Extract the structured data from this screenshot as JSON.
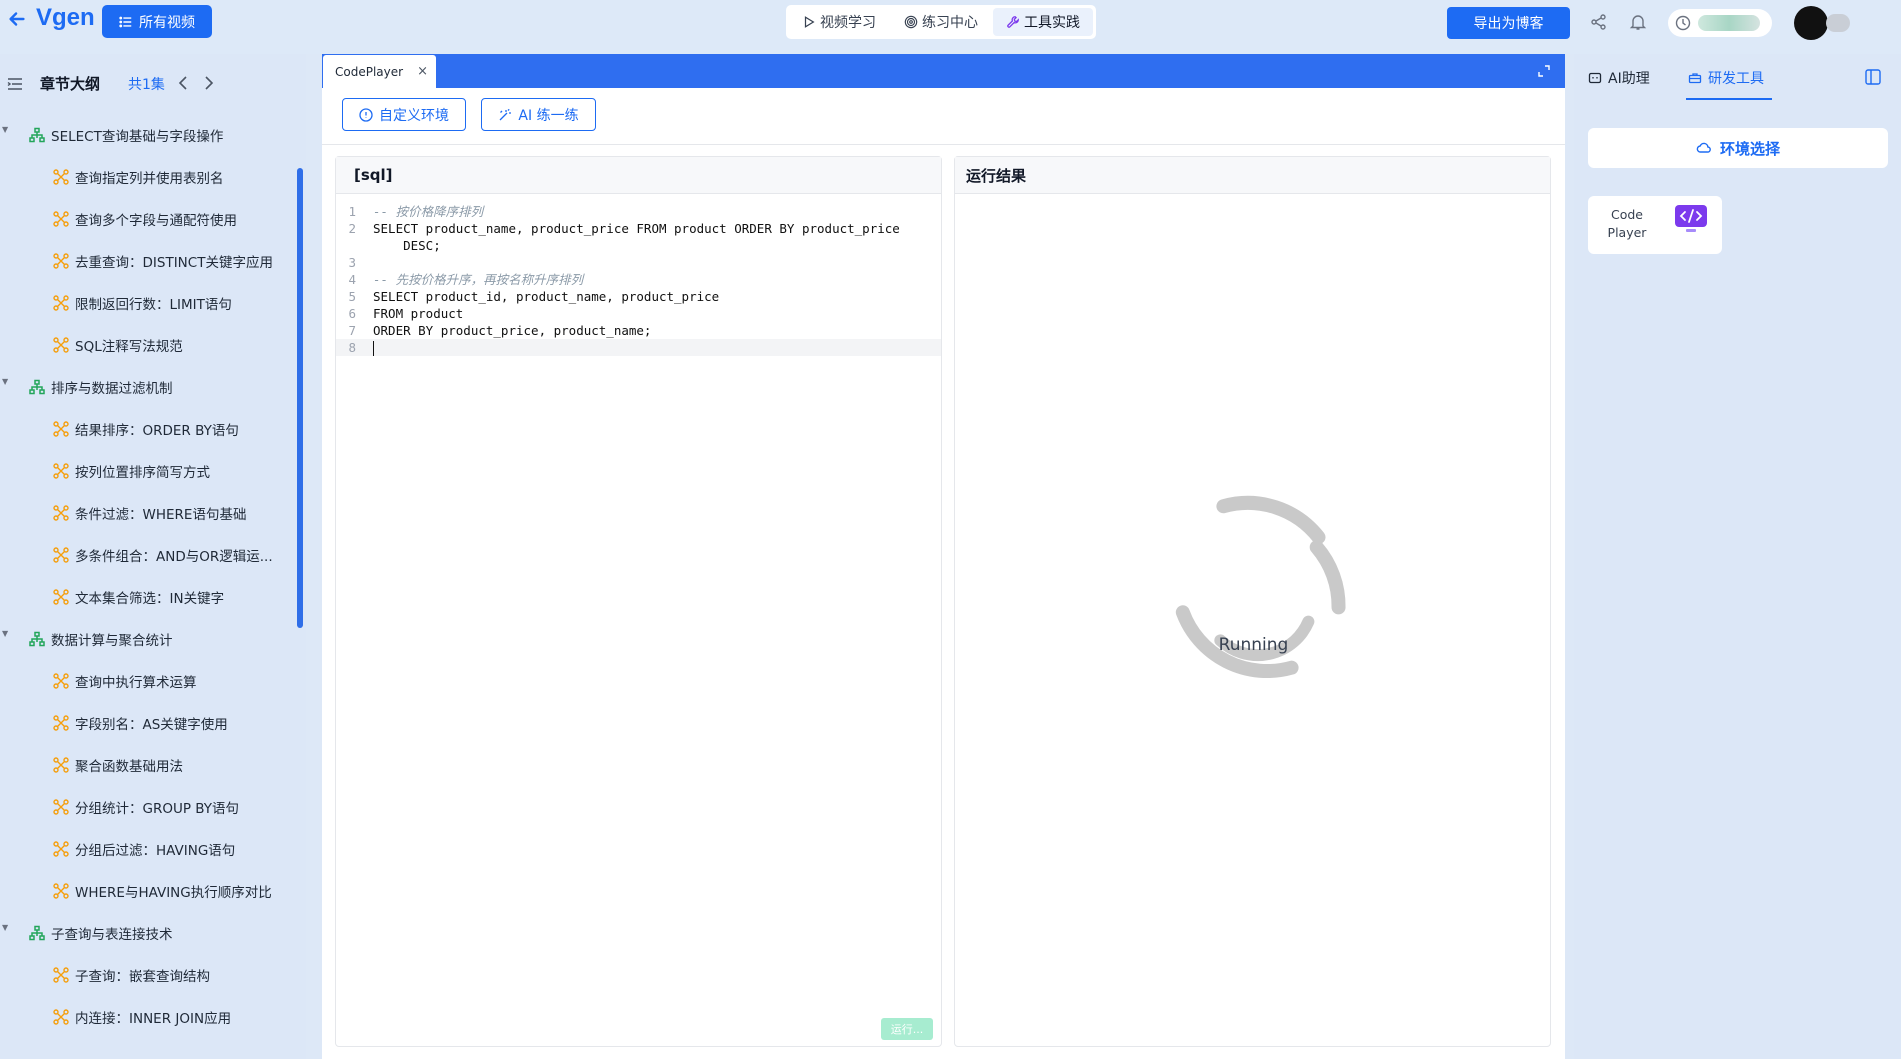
{
  "header": {
    "logo": "Vgen",
    "all_videos_label": "所有视频",
    "tabs": [
      {
        "label": "视频学习",
        "icon": "play-icon"
      },
      {
        "label": "练习中心",
        "icon": "target-icon"
      },
      {
        "label": "工具实践",
        "icon": "wrench-icon",
        "active": true
      }
    ],
    "export_label": "导出为博客",
    "accent_color": "#1d6bf3"
  },
  "sidebar": {
    "title": "章节大纲",
    "count": "共1集",
    "items": [
      {
        "type": "chapter",
        "label": "SELECT查询基础与字段操作"
      },
      {
        "type": "section",
        "label": "查询指定列并使用表别名"
      },
      {
        "type": "section",
        "label": "查询多个字段与通配符使用"
      },
      {
        "type": "section",
        "label": "去重查询：DISTINCT关键字应用"
      },
      {
        "type": "section",
        "label": "限制返回行数：LIMIT语句"
      },
      {
        "type": "section",
        "label": "SQL注释写法规范"
      },
      {
        "type": "chapter",
        "label": "排序与数据过滤机制"
      },
      {
        "type": "section",
        "label": "结果排序：ORDER BY语句"
      },
      {
        "type": "section",
        "label": "按列位置排序简写方式"
      },
      {
        "type": "section",
        "label": "条件过滤：WHERE语句基础"
      },
      {
        "type": "section",
        "label": "多条件组合：AND与OR逻辑运..."
      },
      {
        "type": "section",
        "label": "文本集合筛选：IN关键字"
      },
      {
        "type": "chapter",
        "label": "数据计算与聚合统计"
      },
      {
        "type": "section",
        "label": "查询中执行算术运算"
      },
      {
        "type": "section",
        "label": "字段别名：AS关键字使用"
      },
      {
        "type": "section",
        "label": "聚合函数基础用法"
      },
      {
        "type": "section",
        "label": "分组统计：GROUP BY语句"
      },
      {
        "type": "section",
        "label": "分组后过滤：HAVING语句"
      },
      {
        "type": "section",
        "label": "WHERE与HAVING执行顺序对比"
      },
      {
        "type": "chapter",
        "label": "子查询与表连接技术"
      },
      {
        "type": "section",
        "label": "子查询：嵌套查询结构"
      },
      {
        "type": "section",
        "label": "内连接：INNER JOIN应用"
      }
    ]
  },
  "main": {
    "tab_label": "CodePlayer",
    "tab_close": "×",
    "toolbar": {
      "custom_env_label": "自定义环境",
      "ai_practice_label": "AI 练一练"
    },
    "editor": {
      "title": "[sql]",
      "lines": [
        {
          "n": "1",
          "text": "-- 按价格降序排列",
          "comment": true
        },
        {
          "n": "2",
          "text": "SELECT product_name, product_price FROM product ORDER BY product_price\n    DESC;",
          "comment": false
        },
        {
          "n": "3",
          "text": "",
          "comment": false
        },
        {
          "n": "4",
          "text": "-- 先按价格升序，再按名称升序排列",
          "comment": true
        },
        {
          "n": "5",
          "text": "SELECT product_id, product_name, product_price",
          "comment": false
        },
        {
          "n": "6",
          "text": "FROM product",
          "comment": false
        },
        {
          "n": "7",
          "text": "ORDER BY product_price, product_name;",
          "comment": false
        },
        {
          "n": "8",
          "text": "",
          "comment": false,
          "cursor": true
        }
      ],
      "run_label": "运行..."
    },
    "result": {
      "title": "运行结果",
      "status": "Running"
    }
  },
  "right_panel": {
    "tabs": [
      {
        "label": "AI助理",
        "icon": "bot-icon"
      },
      {
        "label": "研发工具",
        "icon": "toolbox-icon",
        "active": true
      }
    ],
    "env_select_label": "环境选择",
    "card_label": "Code Player"
  }
}
